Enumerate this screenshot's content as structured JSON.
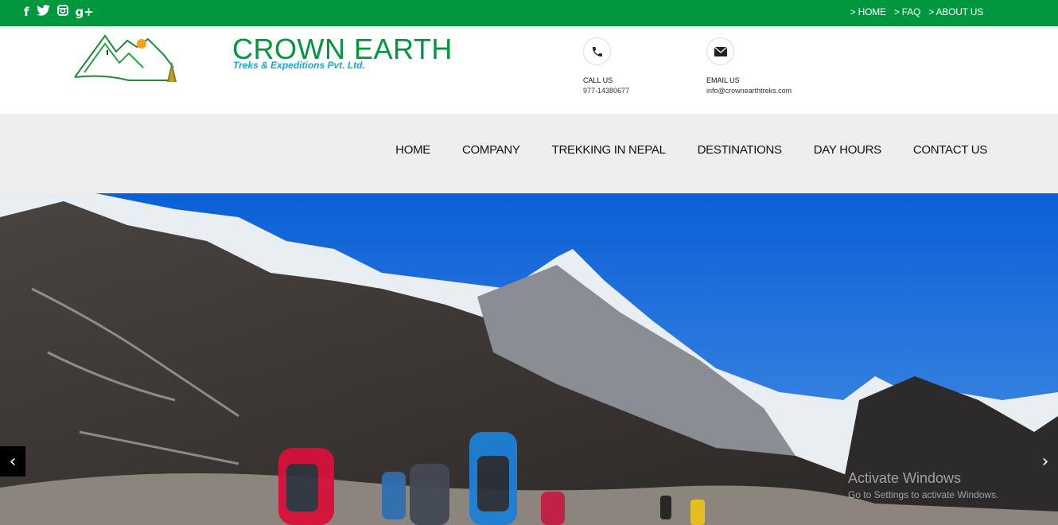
{
  "topbar": {
    "social": [
      {
        "icon": "facebook-icon",
        "glyph": "f"
      },
      {
        "icon": "twitter-icon",
        "glyph": "🐦"
      },
      {
        "icon": "instagram-icon",
        "glyph": "◙"
      },
      {
        "icon": "google-plus-icon",
        "glyph": "g+"
      }
    ],
    "links": [
      "> HOME",
      "> FAQ",
      "> ABOUT US"
    ]
  },
  "brand": {
    "name": "CROWN EARTH",
    "subtitle": "Treks & Expeditions Pvt. Ltd."
  },
  "contact": {
    "call_label": "CALL US",
    "call_value": "977-14380677",
    "email_label": "EMAIL US",
    "email_value": "info@crownearthtreks.com"
  },
  "nav": [
    "HOME",
    "COMPANY",
    "TREKKING IN NEPAL",
    "DESTINATIONS",
    "DAY HOURS",
    "CONTACT US"
  ],
  "slider": {
    "prev": "‹",
    "next": "›"
  },
  "watermark": {
    "line1": "Activate Windows",
    "line2": "Go to Settings to activate Windows."
  },
  "colors": {
    "brand_green": "#00973f",
    "accent_blue": "#1aa6d6",
    "nav_bg": "#eeeeee"
  }
}
